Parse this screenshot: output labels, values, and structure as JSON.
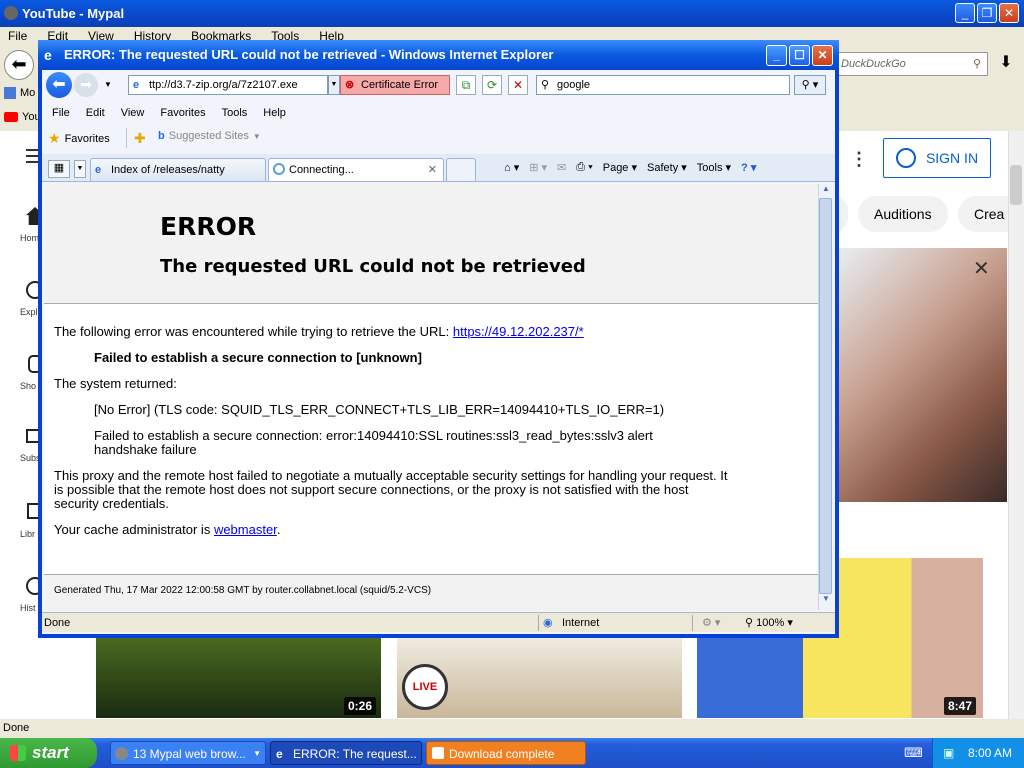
{
  "bg": {
    "title": "YouTube - Mypal",
    "menu": [
      "File",
      "Edit",
      "View",
      "History",
      "Bookmarks",
      "Tools",
      "Help"
    ],
    "search_placeholder": "DuckDuckGo",
    "tab_partial_1": "Mo",
    "tab_partial_2": "You",
    "status": "Done"
  },
  "youtube": {
    "sign_in": "SIGN IN",
    "chips": [
      "Auditions",
      "Crea"
    ],
    "sidebar": [
      "Hom",
      "Expl",
      "Sho",
      "Subscri",
      "Libr",
      "Hist"
    ],
    "durations": [
      "0:26",
      "8:47"
    ],
    "live_label": "LIVE"
  },
  "ie": {
    "title": "ERROR: The requested URL could not be retrieved - Windows Internet Explorer",
    "address": "ttp://d3.7-zip.org/a/7z2107.exe",
    "cert_error": "Certificate Error",
    "search_value": "google",
    "menu": [
      "File",
      "Edit",
      "View",
      "Favorites",
      "Tools",
      "Help"
    ],
    "favorites": "Favorites",
    "suggested_sites": "Suggested Sites",
    "tabs": [
      "Index of /releases/natty",
      "Connecting..."
    ],
    "commands": [
      "Page",
      "Safety",
      "Tools"
    ],
    "status_done": "Done",
    "zone": "Internet",
    "zoom": "100%"
  },
  "page": {
    "error_heading": "ERROR",
    "error_subheading": "The requested URL could not be retrieved",
    "intro": "The following error was encountered while trying to retrieve the URL: ",
    "url_link": "https://49.12.202.237/*",
    "failed": "Failed to establish a secure connection to [unknown]",
    "system_returned": "The system returned:",
    "no_error": "[No Error] (TLS code: SQUID_TLS_ERR_CONNECT+TLS_LIB_ERR=14094410+TLS_IO_ERR=1)",
    "ssl_error_1": "Failed to establish a secure connection: error:14094410:SSL routines:ssl3_read_bytes:sslv3 alert",
    "ssl_error_2": "handshake failure",
    "proxy_1": "This proxy and the remote host failed to negotiate a mutually acceptable security settings for handling your request. It",
    "proxy_2": "is possible that the remote host does not support secure connections, or the proxy is not satisfied with the host",
    "proxy_3": "security credentials.",
    "admin_prefix": "Your cache administrator is ",
    "admin_link": "webmaster",
    "admin_suffix": ".",
    "generated": "Generated Thu, 17 Mar 2022 12:00:58 GMT by router.collabnet.local (squid/5.2-VCS)"
  },
  "taskbar": {
    "start": "start",
    "tasks": [
      "13 Mypal web brow...",
      "ERROR: The request...",
      "Download complete"
    ],
    "clock": "8:00 AM"
  },
  "colors": {
    "xp_blue": "#0a5ae0",
    "link": "#0000ee",
    "cert_red": "#f6a9a9",
    "start_green": "#2f9a2f",
    "yt_blue": "#065fd4"
  }
}
